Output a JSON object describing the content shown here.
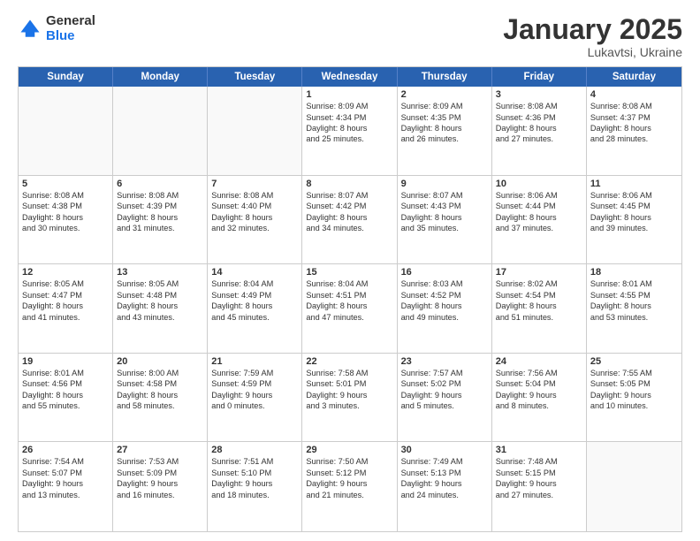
{
  "logo": {
    "general": "General",
    "blue": "Blue"
  },
  "header": {
    "month": "January 2025",
    "location": "Lukavtsi, Ukraine"
  },
  "weekdays": [
    "Sunday",
    "Monday",
    "Tuesday",
    "Wednesday",
    "Thursday",
    "Friday",
    "Saturday"
  ],
  "weeks": [
    [
      {
        "day": "",
        "text": ""
      },
      {
        "day": "",
        "text": ""
      },
      {
        "day": "",
        "text": ""
      },
      {
        "day": "1",
        "text": "Sunrise: 8:09 AM\nSunset: 4:34 PM\nDaylight: 8 hours\nand 25 minutes."
      },
      {
        "day": "2",
        "text": "Sunrise: 8:09 AM\nSunset: 4:35 PM\nDaylight: 8 hours\nand 26 minutes."
      },
      {
        "day": "3",
        "text": "Sunrise: 8:08 AM\nSunset: 4:36 PM\nDaylight: 8 hours\nand 27 minutes."
      },
      {
        "day": "4",
        "text": "Sunrise: 8:08 AM\nSunset: 4:37 PM\nDaylight: 8 hours\nand 28 minutes."
      }
    ],
    [
      {
        "day": "5",
        "text": "Sunrise: 8:08 AM\nSunset: 4:38 PM\nDaylight: 8 hours\nand 30 minutes."
      },
      {
        "day": "6",
        "text": "Sunrise: 8:08 AM\nSunset: 4:39 PM\nDaylight: 8 hours\nand 31 minutes."
      },
      {
        "day": "7",
        "text": "Sunrise: 8:08 AM\nSunset: 4:40 PM\nDaylight: 8 hours\nand 32 minutes."
      },
      {
        "day": "8",
        "text": "Sunrise: 8:07 AM\nSunset: 4:42 PM\nDaylight: 8 hours\nand 34 minutes."
      },
      {
        "day": "9",
        "text": "Sunrise: 8:07 AM\nSunset: 4:43 PM\nDaylight: 8 hours\nand 35 minutes."
      },
      {
        "day": "10",
        "text": "Sunrise: 8:06 AM\nSunset: 4:44 PM\nDaylight: 8 hours\nand 37 minutes."
      },
      {
        "day": "11",
        "text": "Sunrise: 8:06 AM\nSunset: 4:45 PM\nDaylight: 8 hours\nand 39 minutes."
      }
    ],
    [
      {
        "day": "12",
        "text": "Sunrise: 8:05 AM\nSunset: 4:47 PM\nDaylight: 8 hours\nand 41 minutes."
      },
      {
        "day": "13",
        "text": "Sunrise: 8:05 AM\nSunset: 4:48 PM\nDaylight: 8 hours\nand 43 minutes."
      },
      {
        "day": "14",
        "text": "Sunrise: 8:04 AM\nSunset: 4:49 PM\nDaylight: 8 hours\nand 45 minutes."
      },
      {
        "day": "15",
        "text": "Sunrise: 8:04 AM\nSunset: 4:51 PM\nDaylight: 8 hours\nand 47 minutes."
      },
      {
        "day": "16",
        "text": "Sunrise: 8:03 AM\nSunset: 4:52 PM\nDaylight: 8 hours\nand 49 minutes."
      },
      {
        "day": "17",
        "text": "Sunrise: 8:02 AM\nSunset: 4:54 PM\nDaylight: 8 hours\nand 51 minutes."
      },
      {
        "day": "18",
        "text": "Sunrise: 8:01 AM\nSunset: 4:55 PM\nDaylight: 8 hours\nand 53 minutes."
      }
    ],
    [
      {
        "day": "19",
        "text": "Sunrise: 8:01 AM\nSunset: 4:56 PM\nDaylight: 8 hours\nand 55 minutes."
      },
      {
        "day": "20",
        "text": "Sunrise: 8:00 AM\nSunset: 4:58 PM\nDaylight: 8 hours\nand 58 minutes."
      },
      {
        "day": "21",
        "text": "Sunrise: 7:59 AM\nSunset: 4:59 PM\nDaylight: 9 hours\nand 0 minutes."
      },
      {
        "day": "22",
        "text": "Sunrise: 7:58 AM\nSunset: 5:01 PM\nDaylight: 9 hours\nand 3 minutes."
      },
      {
        "day": "23",
        "text": "Sunrise: 7:57 AM\nSunset: 5:02 PM\nDaylight: 9 hours\nand 5 minutes."
      },
      {
        "day": "24",
        "text": "Sunrise: 7:56 AM\nSunset: 5:04 PM\nDaylight: 9 hours\nand 8 minutes."
      },
      {
        "day": "25",
        "text": "Sunrise: 7:55 AM\nSunset: 5:05 PM\nDaylight: 9 hours\nand 10 minutes."
      }
    ],
    [
      {
        "day": "26",
        "text": "Sunrise: 7:54 AM\nSunset: 5:07 PM\nDaylight: 9 hours\nand 13 minutes."
      },
      {
        "day": "27",
        "text": "Sunrise: 7:53 AM\nSunset: 5:09 PM\nDaylight: 9 hours\nand 16 minutes."
      },
      {
        "day": "28",
        "text": "Sunrise: 7:51 AM\nSunset: 5:10 PM\nDaylight: 9 hours\nand 18 minutes."
      },
      {
        "day": "29",
        "text": "Sunrise: 7:50 AM\nSunset: 5:12 PM\nDaylight: 9 hours\nand 21 minutes."
      },
      {
        "day": "30",
        "text": "Sunrise: 7:49 AM\nSunset: 5:13 PM\nDaylight: 9 hours\nand 24 minutes."
      },
      {
        "day": "31",
        "text": "Sunrise: 7:48 AM\nSunset: 5:15 PM\nDaylight: 9 hours\nand 27 minutes."
      },
      {
        "day": "",
        "text": ""
      }
    ]
  ]
}
